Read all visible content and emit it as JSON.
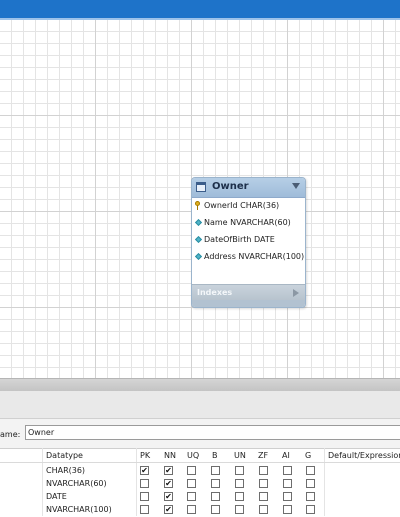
{
  "entity": {
    "title": "Owner",
    "columns": [
      {
        "text": "OwnerId CHAR(36)",
        "icon": "key-icon"
      },
      {
        "text": "Name NVARCHAR(60)",
        "icon": "diamond-icon"
      },
      {
        "text": "DateOfBirth DATE",
        "icon": "diamond-icon"
      },
      {
        "text": "Address NVARCHAR(100)",
        "icon": "diamond-icon"
      }
    ],
    "indexes_label": "Indexes"
  },
  "editor": {
    "name_label": "ame:",
    "name_value": "Owner",
    "headers": {
      "datatype": "Datatype",
      "pk": "PK",
      "nn": "NN",
      "uq": "UQ",
      "b": "B",
      "un": "UN",
      "zf": "ZF",
      "ai": "AI",
      "g": "G",
      "default": "Default/Expression"
    },
    "rows": [
      {
        "datatype": "CHAR(36)",
        "pk": true,
        "nn": true,
        "uq": false,
        "b": false,
        "un": false,
        "zf": false,
        "ai": false,
        "g": false
      },
      {
        "datatype": "NVARCHAR(60)",
        "pk": false,
        "nn": true,
        "uq": false,
        "b": false,
        "un": false,
        "zf": false,
        "ai": false,
        "g": false
      },
      {
        "datatype": "DATE",
        "pk": false,
        "nn": true,
        "uq": false,
        "b": false,
        "un": false,
        "zf": false,
        "ai": false,
        "g": false
      },
      {
        "datatype": "NVARCHAR(100)",
        "pk": false,
        "nn": true,
        "uq": false,
        "b": false,
        "un": false,
        "zf": false,
        "ai": false,
        "g": false
      }
    ]
  },
  "colors": {
    "title_bar": "#1e73c9",
    "entity_header": "#9fbcd9"
  }
}
